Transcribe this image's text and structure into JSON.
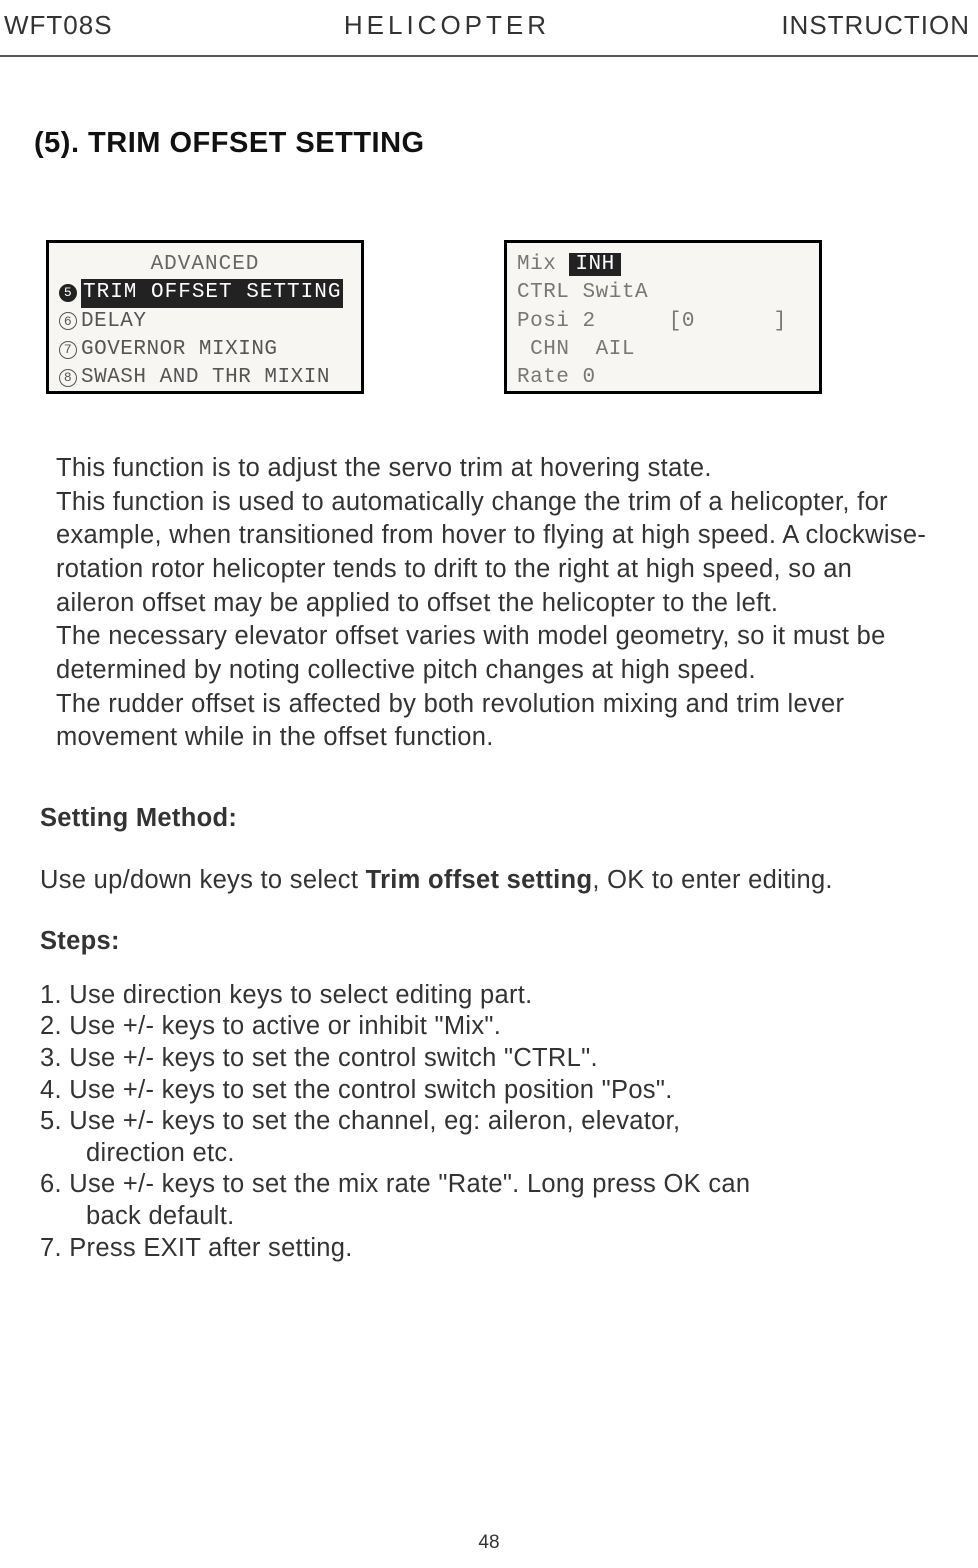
{
  "header": {
    "left": "WFT08S",
    "center": "HELICOPTER",
    "right": "INSTRUCTION"
  },
  "section_title": "(5). TRIM OFFSET SETTING",
  "screen1": {
    "title": "ADVANCED",
    "item5_num": "5",
    "item5": "TRIM OFFSET SETTING",
    "item6_num": "6",
    "item6": "DELAY",
    "item7_num": "7",
    "item7": "GOVERNOR MIXING",
    "item8_num": "8",
    "item8": "SWASH AND THR MIXIN"
  },
  "screen2": {
    "r1a": "Mix",
    "r1b": "INH",
    "r2a": "CTRL",
    "r2b": "SwitA",
    "r3a": "Posi",
    "r3b": "2",
    "r3c": "[0",
    "r3d": "]",
    "r4a": "CHN",
    "r4b": "AIL",
    "r5a": "Rate",
    "r5b": "0"
  },
  "body": {
    "p1": "This function is to adjust the servo trim at hovering state.",
    "p2": "This function is used to automatically change the trim of a helicopter, for example, when transitioned from hover to flying at high speed. A clockwise-rotation rotor helicopter tends to drift to the right at high speed, so an aileron offset may be applied to offset the helicopter to the left.",
    "p3": "The necessary elevator offset varies with model geometry, so it must be determined by noting collective pitch changes at high speed.",
    "p4": "The rudder offset is affected by both revolution mixing and trim lever movement while in the offset function."
  },
  "method": {
    "heading": "Setting Method:",
    "intro_a": "Use up/down keys to select ",
    "intro_bold": "Trim offset setting",
    "intro_b": ", OK to enter editing.",
    "steps_heading": "Steps:",
    "s1": "1. Use direction keys to select editing part.",
    "s2": "2. Use +/- keys to active or inhibit \"Mix\".",
    "s3": "3. Use +/- keys to set the control switch \"CTRL\".",
    "s4": "4. Use +/- keys to set the control switch position \"Pos\".",
    "s5": "5. Use +/- keys to set the channel, eg: aileron, elevator,",
    "s5b": "direction etc.",
    "s6": "6. Use +/- keys to set the mix rate \"Rate\". Long press OK can",
    "s6b": "back default.",
    "s7": "7. Press EXIT after setting."
  },
  "page_number": "48"
}
